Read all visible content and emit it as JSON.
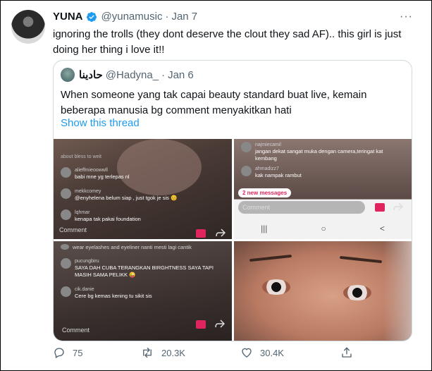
{
  "tweet": {
    "display_name": "YUNA",
    "handle": "@yunamusic",
    "separator": "·",
    "date": "Jan 7",
    "more": "···",
    "text": "ignoring the trolls (they dont deserve the clout they sad AF).. this girl is just doing her thing i love it!!"
  },
  "quote": {
    "display_name": "حادينا",
    "handle": "@Hadyna_",
    "separator": "·",
    "date": "Jan 6",
    "text": "When someone yang tak capai beauty standard buat live, kemain beberapa manusia bg comment menyakitkan hati",
    "link": "Show this thread"
  },
  "media": {
    "tile1": {
      "comments": [
        {
          "user": "alieffmieoowwll",
          "msg": "babi mne yg terlepas nl"
        },
        {
          "user": "mekkcomey",
          "msg": "@enyhelena belum siap , just tgok je sis 😊"
        },
        {
          "user": "lqhmar",
          "msg": "kenapa tak pakai foundation"
        }
      ],
      "top_comment": "about bless to weit",
      "comment_label": "Comment"
    },
    "tile2": {
      "comments": [
        {
          "user": "najmiecamil",
          "msg": "jangan dekat sangat muka dengan camera,teringat kat kembang"
        },
        {
          "user": "ahmadizz7",
          "msg": "kak nampak rambut"
        }
      ],
      "new_messages": "2 new messages",
      "comment_label": "Comment",
      "nav": [
        "|||",
        "○",
        "<"
      ]
    },
    "tile3": {
      "comments": [
        {
          "user": "",
          "msg": "wear eyelashes and eyeliner nanti mesti lagi cantik"
        },
        {
          "user": "pucungbiru",
          "msg": "SAYA DAH CUBA TERANGKAN BIRGHTNESS SAYA TAPI MASIH SAMA PELIKK 😜"
        },
        {
          "user": "cik.danie",
          "msg": "Cere bg kemas kening tu sikit sis"
        }
      ],
      "comment_label": "Comment"
    }
  },
  "actions": {
    "reply_count": "75",
    "retweet_count": "20.3K",
    "like_count": "30.4K"
  },
  "icons": {
    "verified": "verified-badge-icon",
    "reply": "reply-icon",
    "retweet": "retweet-icon",
    "like": "heart-icon",
    "share": "share-icon"
  },
  "colors": {
    "accent": "#1d9bf0",
    "muted": "#536471",
    "text": "#0f1419",
    "border": "#cfd9de"
  }
}
